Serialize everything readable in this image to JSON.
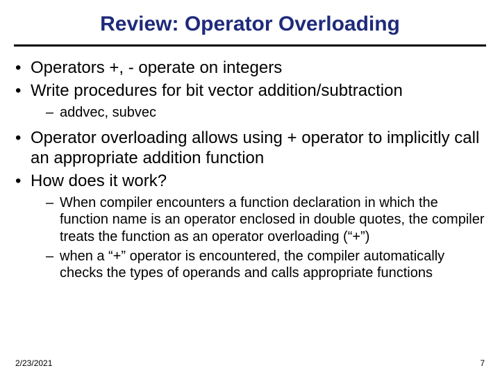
{
  "title": "Review: Operator Overloading",
  "bullets": {
    "b0": "Operators +, - operate on integers",
    "b1": "Write procedures for bit vector addition/subtraction",
    "b1_sub0": "addvec, subvec",
    "b2": "Operator overloading allows using + operator to implicitly call an appropriate addition function",
    "b3": "How does it work?",
    "b3_sub0": "When compiler encounters a function declaration in which the function name is an operator enclosed in double quotes, the compiler treats the function as an operator overloading (“+”)",
    "b3_sub1": "when a “+” operator is encountered, the compiler automatically checks the types of operands and calls appropriate functions"
  },
  "footer": {
    "date": "2/23/2021",
    "page": "7"
  }
}
